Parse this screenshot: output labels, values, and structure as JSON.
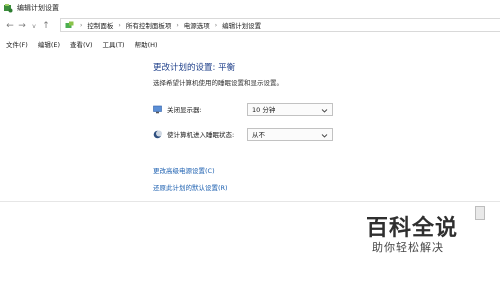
{
  "window": {
    "title": "编辑计划设置"
  },
  "address": {
    "crumbs": [
      "控制面板",
      "所有控制面板项",
      "电源选项",
      "编辑计划设置"
    ]
  },
  "menubar": {
    "items": [
      "文件(F)",
      "编辑(E)",
      "查看(V)",
      "工具(T)",
      "帮助(H)"
    ]
  },
  "main": {
    "title": "更改计划的设置: 平衡",
    "description": "选择希望计算机使用的睡眠设置和显示设置。",
    "settings": [
      {
        "label": "关闭显示器:",
        "value": "10 分钟",
        "icon": "monitor-icon"
      },
      {
        "label": "使计算机进入睡眠状态:",
        "value": "从不",
        "icon": "moon-icon"
      }
    ],
    "links": [
      "更改高级电源设置(C)",
      "还原此计划的默认设置(R)"
    ]
  },
  "watermark": {
    "title": "百科全说",
    "subtitle": "助你轻松解决"
  },
  "colors": {
    "link": "#1b5fb0",
    "title": "#1e3f8a"
  }
}
